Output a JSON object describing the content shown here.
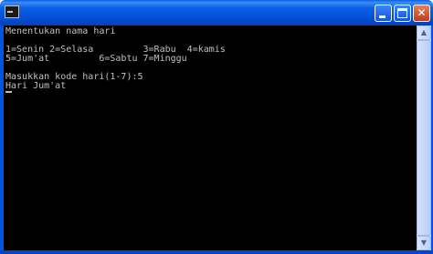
{
  "window": {
    "title": "",
    "icon": "console-icon"
  },
  "controls": {
    "minimize": "_",
    "maximize": "□",
    "close": "✕"
  },
  "console": {
    "lines": [
      "Menentukan nama hari",
      "",
      "1=Senin 2=Selasa         3=Rabu  4=kamis",
      "5=Jum'at         6=Sabtu 7=Minggu",
      "",
      "Masukkan kode hari(1-7):5",
      "Hari Jum'at"
    ]
  },
  "scrollbar": {
    "up": "▲",
    "down": "▼"
  }
}
